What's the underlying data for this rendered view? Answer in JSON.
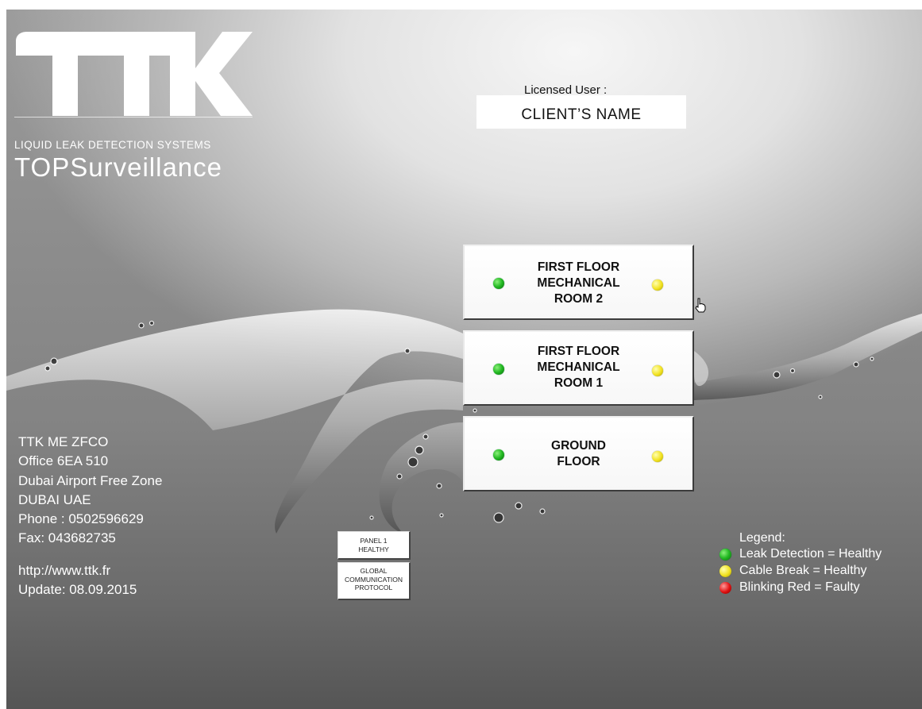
{
  "brand": {
    "logo_text": "TTK",
    "tagline": "LIQUID LEAK DETECTION SYSTEMS",
    "product": "TOPSurveillance"
  },
  "license": {
    "label": "Licensed User :",
    "client_name": "CLIENT’S NAME"
  },
  "zones": [
    {
      "line1": "FIRST FLOOR",
      "line2": "MECHANICAL",
      "line3": "ROOM 2",
      "leak_status": "green",
      "cable_status": "yellow"
    },
    {
      "line1": "FIRST FLOOR",
      "line2": "MECHANICAL",
      "line3": "ROOM 1",
      "leak_status": "green",
      "cable_status": "yellow"
    },
    {
      "line1": "GROUND",
      "line2": "FLOOR",
      "leak_status": "green",
      "cable_status": "yellow"
    }
  ],
  "address": {
    "company": "TTK ME ZFCO",
    "office": "Office 6EA 510",
    "zone": "Dubai Airport Free Zone",
    "city": "DUBAI UAE",
    "phone": "Phone : 0502596629",
    "fax": "Fax: 043682735",
    "website": "http://www.ttk.fr",
    "update": "Update: 08.09.2015"
  },
  "panel_buttons": {
    "panel_line1": "PANEL 1",
    "panel_line2": "HEALTHY",
    "protocol_line1": "GLOBAL",
    "protocol_line2": "COMMUNICATION",
    "protocol_line3": "PROTOCOL"
  },
  "legend": {
    "title": "Legend:",
    "items": [
      {
        "color": "green",
        "label": "Leak Detection = Healthy"
      },
      {
        "color": "yellow",
        "label": "Cable Break = Healthy"
      },
      {
        "color": "red",
        "label": "Blinking Red = Faulty"
      }
    ]
  },
  "colors": {
    "led_green": "#22b822",
    "led_yellow": "#f2e21f",
    "led_red": "#e11010"
  }
}
